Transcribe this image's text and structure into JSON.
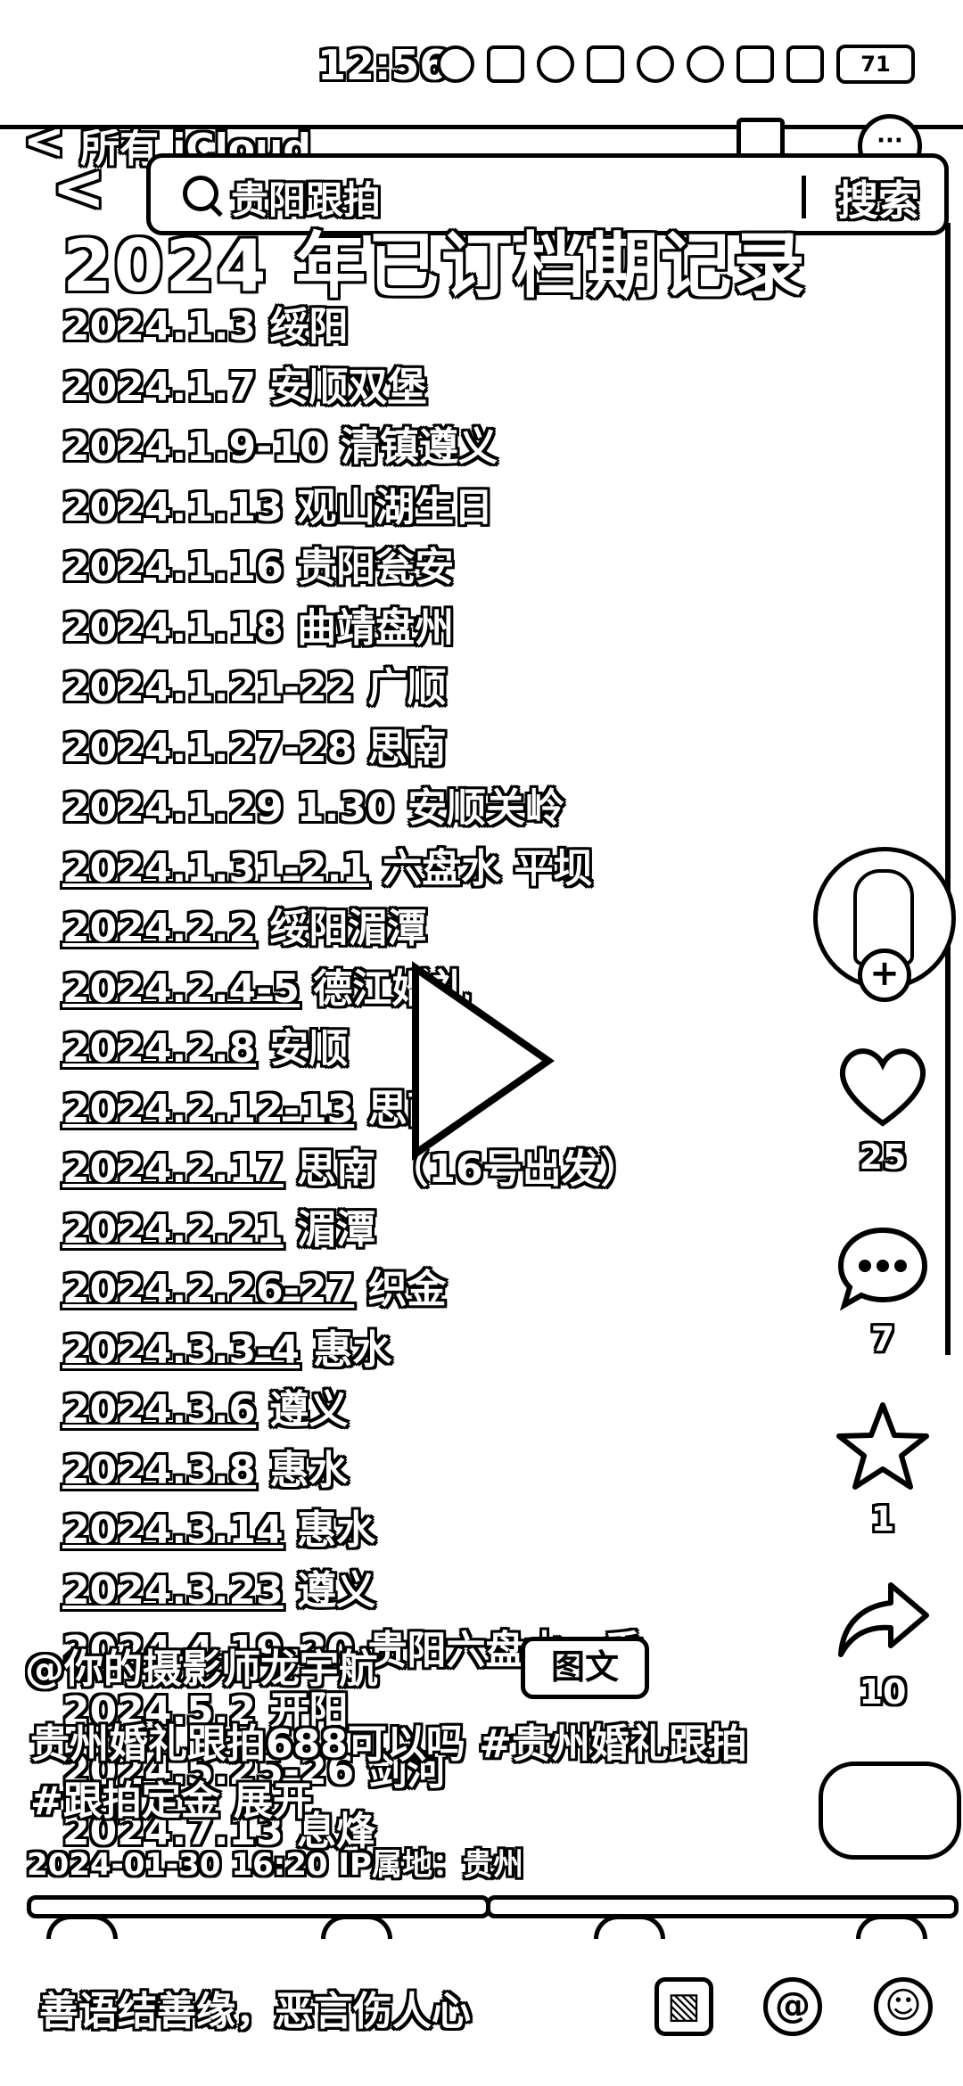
{
  "status_bar": {
    "time": "12:56",
    "battery": "71"
  },
  "nav": {
    "back_label": "所有 iCloud",
    "search_placeholder": "贵阳跟拍",
    "search_button": "搜索"
  },
  "post": {
    "title": "2024 年已订档期记录",
    "records": [
      {
        "date": "2024.1.3",
        "place": "绥阳"
      },
      {
        "date": "2024.1.7",
        "place": "安顺双堡"
      },
      {
        "date": "2024.1.9-10",
        "place": "清镇遵义"
      },
      {
        "date": "2024.1.13",
        "place": "观山湖生日"
      },
      {
        "date": "2024.1.16",
        "place": "贵阳瓮安"
      },
      {
        "date": "2024.1.18",
        "place": "曲靖盘州"
      },
      {
        "date": "2024.1.21-22",
        "place": "广顺"
      },
      {
        "date": "2024.1.27-28",
        "place": "思南"
      },
      {
        "date": "2024.1.29 1.30",
        "place": "安顺关岭"
      },
      {
        "date": "2024.1.31-2.1",
        "place": "六盘水 平坝"
      },
      {
        "date": "2024.2.2",
        "place": "绥阳湄潭"
      },
      {
        "date": "2024.2.4-5",
        "place": "德江婚礼"
      },
      {
        "date": "2024.2.8",
        "place": "安顺"
      },
      {
        "date": "2024.2.12-13",
        "place": "思南"
      },
      {
        "date": "2024.2.17",
        "place": "思南 （16号出发）"
      },
      {
        "date": "2024.2.21",
        "place": "湄潭"
      },
      {
        "date": "2024.2.26-27",
        "place": "织金"
      },
      {
        "date": "2024.3.3-4",
        "place": "惠水"
      },
      {
        "date": "2024.3.6",
        "place": "遵义"
      },
      {
        "date": "2024.3.8",
        "place": "惠水"
      },
      {
        "date": "2024.3.14",
        "place": "惠水"
      },
      {
        "date": "2024.3.23",
        "place": "遵义"
      },
      {
        "date": "2024.4.19-20",
        "place": "贵阳六盘水一香"
      },
      {
        "date": "2024.5.2",
        "place": "开阳"
      },
      {
        "date": "2024.5.25-26",
        "place": "剑河"
      },
      {
        "date": "2024.7.13",
        "place": "息烽"
      }
    ],
    "author": "@你的摄影师龙宇航",
    "tag_chip": "图文",
    "caption": "贵州婚礼跟拍688可以吗 #贵州婚礼跟拍 #跟拍定金 展开",
    "meta": "2024-01-30 16:20  IP属地：贵州"
  },
  "rail": {
    "likes": "25",
    "comments": "7",
    "favorites": "1",
    "shares": "10"
  },
  "comment_bar": {
    "placeholder": "善语结善缘，恶言伤人心"
  }
}
